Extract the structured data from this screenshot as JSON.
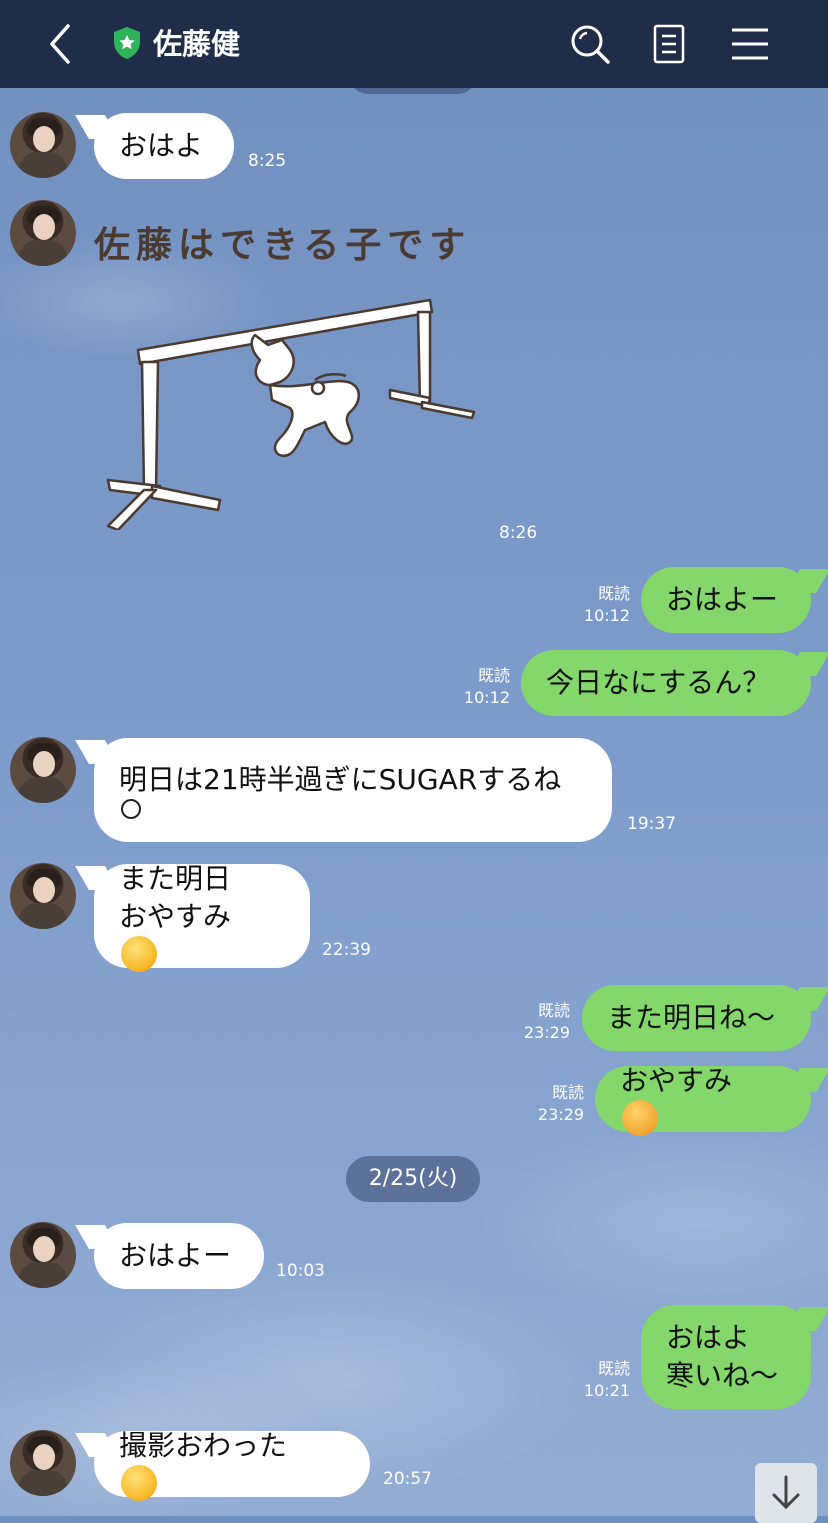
{
  "header": {
    "title": "佐藤健",
    "icons": [
      "back-chevron-icon",
      "shield-star-icon",
      "search-icon",
      "notes-icon",
      "menu-icon"
    ]
  },
  "colors": {
    "header_bg": "#1f2d49",
    "outgoing_bubble": "#84d76a",
    "incoming_bubble": "#ffffff",
    "chat_bg": "#7896c6"
  },
  "messages": [
    {
      "dir": "in",
      "text": "おはよ",
      "time": "8:25"
    },
    {
      "dir": "in",
      "type": "sticker",
      "sticker_text": "佐藤はできる子です",
      "time": "8:26"
    },
    {
      "dir": "out",
      "text": "おはよー",
      "read": "既読",
      "time": "10:12"
    },
    {
      "dir": "out",
      "text": "今日なにするん？",
      "read": "既読",
      "time": "10:12"
    },
    {
      "dir": "in",
      "text_line1": "明日は21時半過ぎにSUGARするね",
      "emoji": "smiling-face",
      "time": "19:37"
    },
    {
      "dir": "in",
      "text_line1": "また明日",
      "text_line2": "おやすみ",
      "emoji": "relieved-face",
      "time": "22:39"
    },
    {
      "dir": "out",
      "text": "また明日ね〜",
      "read": "既読",
      "time": "23:29"
    },
    {
      "dir": "out",
      "text": "おやすみ",
      "emoji": "smiling-face-with-hearts",
      "read": "既読",
      "time": "23:29"
    },
    {
      "dir": "in",
      "text": "おはよー",
      "time": "10:03"
    },
    {
      "dir": "out",
      "text_line1": "おはよ",
      "text_line2": "寒いね〜",
      "read": "既読",
      "time": "10:21"
    },
    {
      "dir": "in",
      "text": "撮影おわった",
      "emoji": "eye-roll-face",
      "time": "20:57"
    }
  ],
  "date_divider": "2/25(火)",
  "scroll_button": "scroll-down-icon"
}
